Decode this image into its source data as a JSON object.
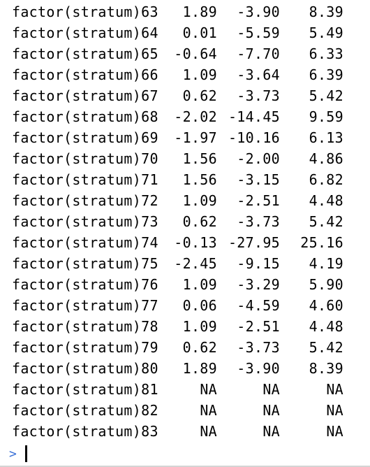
{
  "console": {
    "rows": [
      {
        "name": "factor(stratum)63",
        "est": "1.89",
        "lower": "-3.90",
        "upper": "8.39"
      },
      {
        "name": "factor(stratum)64",
        "est": "0.01",
        "lower": "-5.59",
        "upper": "5.49"
      },
      {
        "name": "factor(stratum)65",
        "est": "-0.64",
        "lower": "-7.70",
        "upper": "6.33"
      },
      {
        "name": "factor(stratum)66",
        "est": "1.09",
        "lower": "-3.64",
        "upper": "6.39"
      },
      {
        "name": "factor(stratum)67",
        "est": "0.62",
        "lower": "-3.73",
        "upper": "5.42"
      },
      {
        "name": "factor(stratum)68",
        "est": "-2.02",
        "lower": "-14.45",
        "upper": "9.59"
      },
      {
        "name": "factor(stratum)69",
        "est": "-1.97",
        "lower": "-10.16",
        "upper": "6.13"
      },
      {
        "name": "factor(stratum)70",
        "est": "1.56",
        "lower": "-2.00",
        "upper": "4.86"
      },
      {
        "name": "factor(stratum)71",
        "est": "1.56",
        "lower": "-3.15",
        "upper": "6.82"
      },
      {
        "name": "factor(stratum)72",
        "est": "1.09",
        "lower": "-2.51",
        "upper": "4.48"
      },
      {
        "name": "factor(stratum)73",
        "est": "0.62",
        "lower": "-3.73",
        "upper": "5.42"
      },
      {
        "name": "factor(stratum)74",
        "est": "-0.13",
        "lower": "-27.95",
        "upper": "25.16"
      },
      {
        "name": "factor(stratum)75",
        "est": "-2.45",
        "lower": "-9.15",
        "upper": "4.19"
      },
      {
        "name": "factor(stratum)76",
        "est": "1.09",
        "lower": "-3.29",
        "upper": "5.90"
      },
      {
        "name": "factor(stratum)77",
        "est": "0.06",
        "lower": "-4.59",
        "upper": "4.60"
      },
      {
        "name": "factor(stratum)78",
        "est": "1.09",
        "lower": "-2.51",
        "upper": "4.48"
      },
      {
        "name": "factor(stratum)79",
        "est": "0.62",
        "lower": "-3.73",
        "upper": "5.42"
      },
      {
        "name": "factor(stratum)80",
        "est": "1.89",
        "lower": "-3.90",
        "upper": "8.39"
      },
      {
        "name": "factor(stratum)81",
        "est": "NA",
        "lower": "NA",
        "upper": "NA"
      },
      {
        "name": "factor(stratum)82",
        "est": "NA",
        "lower": "NA",
        "upper": "NA"
      },
      {
        "name": "factor(stratum)83",
        "est": "NA",
        "lower": "NA",
        "upper": "NA"
      }
    ],
    "prompt_symbol": ">"
  },
  "colors": {
    "background": "#ffffff",
    "text": "#000000",
    "prompt": "#3a70d6"
  }
}
